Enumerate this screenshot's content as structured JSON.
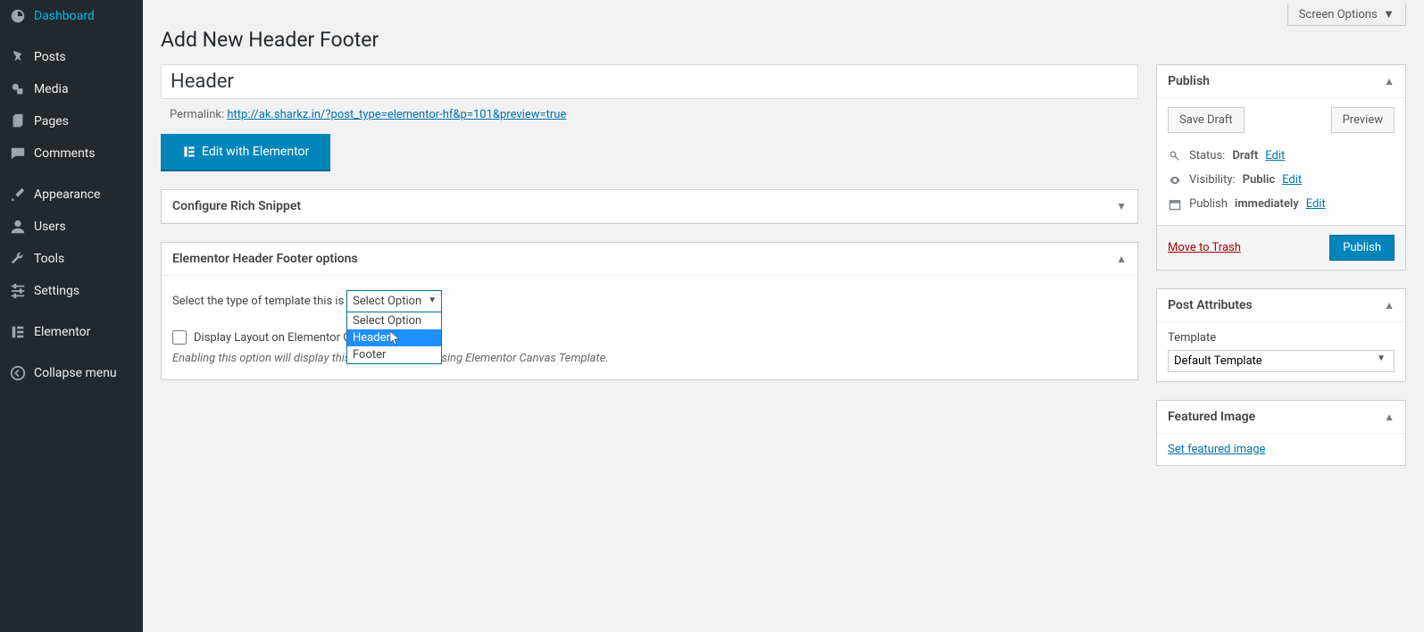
{
  "sidebar": {
    "items": [
      {
        "label": "Dashboard"
      },
      {
        "label": "Posts"
      },
      {
        "label": "Media"
      },
      {
        "label": "Pages"
      },
      {
        "label": "Comments"
      },
      {
        "label": "Appearance"
      },
      {
        "label": "Users"
      },
      {
        "label": "Tools"
      },
      {
        "label": "Settings"
      },
      {
        "label": "Elementor"
      },
      {
        "label": "Collapse menu"
      }
    ]
  },
  "top": {
    "screen_options": "Screen Options"
  },
  "page": {
    "title": "Add New Header Footer",
    "post_title": "Header",
    "permalink_label": "Permalink:",
    "permalink_url": "http://ak.sharkz.in/?post_type=elementor-hf&p=101&preview=true",
    "edit_elementor": "Edit with Elementor"
  },
  "boxes": {
    "rich_snippet_title": "Configure Rich Snippet",
    "hf_options_title": "Elementor Header Footer options",
    "template_type_label": "Select the type of template this is",
    "select_placeholder": "Select Option",
    "dropdown": {
      "opt0": "Select Option",
      "opt1": "Header",
      "opt2": "Footer"
    },
    "display_layout_label": "Display Layout on Elementor Canvas Template?",
    "display_layout_help": "Enabling this option will display this layout on pages using Elementor Canvas Template."
  },
  "publish": {
    "title": "Publish",
    "save_draft": "Save Draft",
    "preview": "Preview",
    "status_label": "Status:",
    "status_value": "Draft",
    "visibility_label": "Visibility:",
    "visibility_value": "Public",
    "publish_label": "Publish",
    "publish_value": "immediately",
    "edit": "Edit",
    "trash": "Move to Trash",
    "submit": "Publish"
  },
  "attributes": {
    "title": "Post Attributes",
    "template_label": "Template",
    "template_value": "Default Template"
  },
  "featured": {
    "title": "Featured Image",
    "link": "Set featured image"
  }
}
